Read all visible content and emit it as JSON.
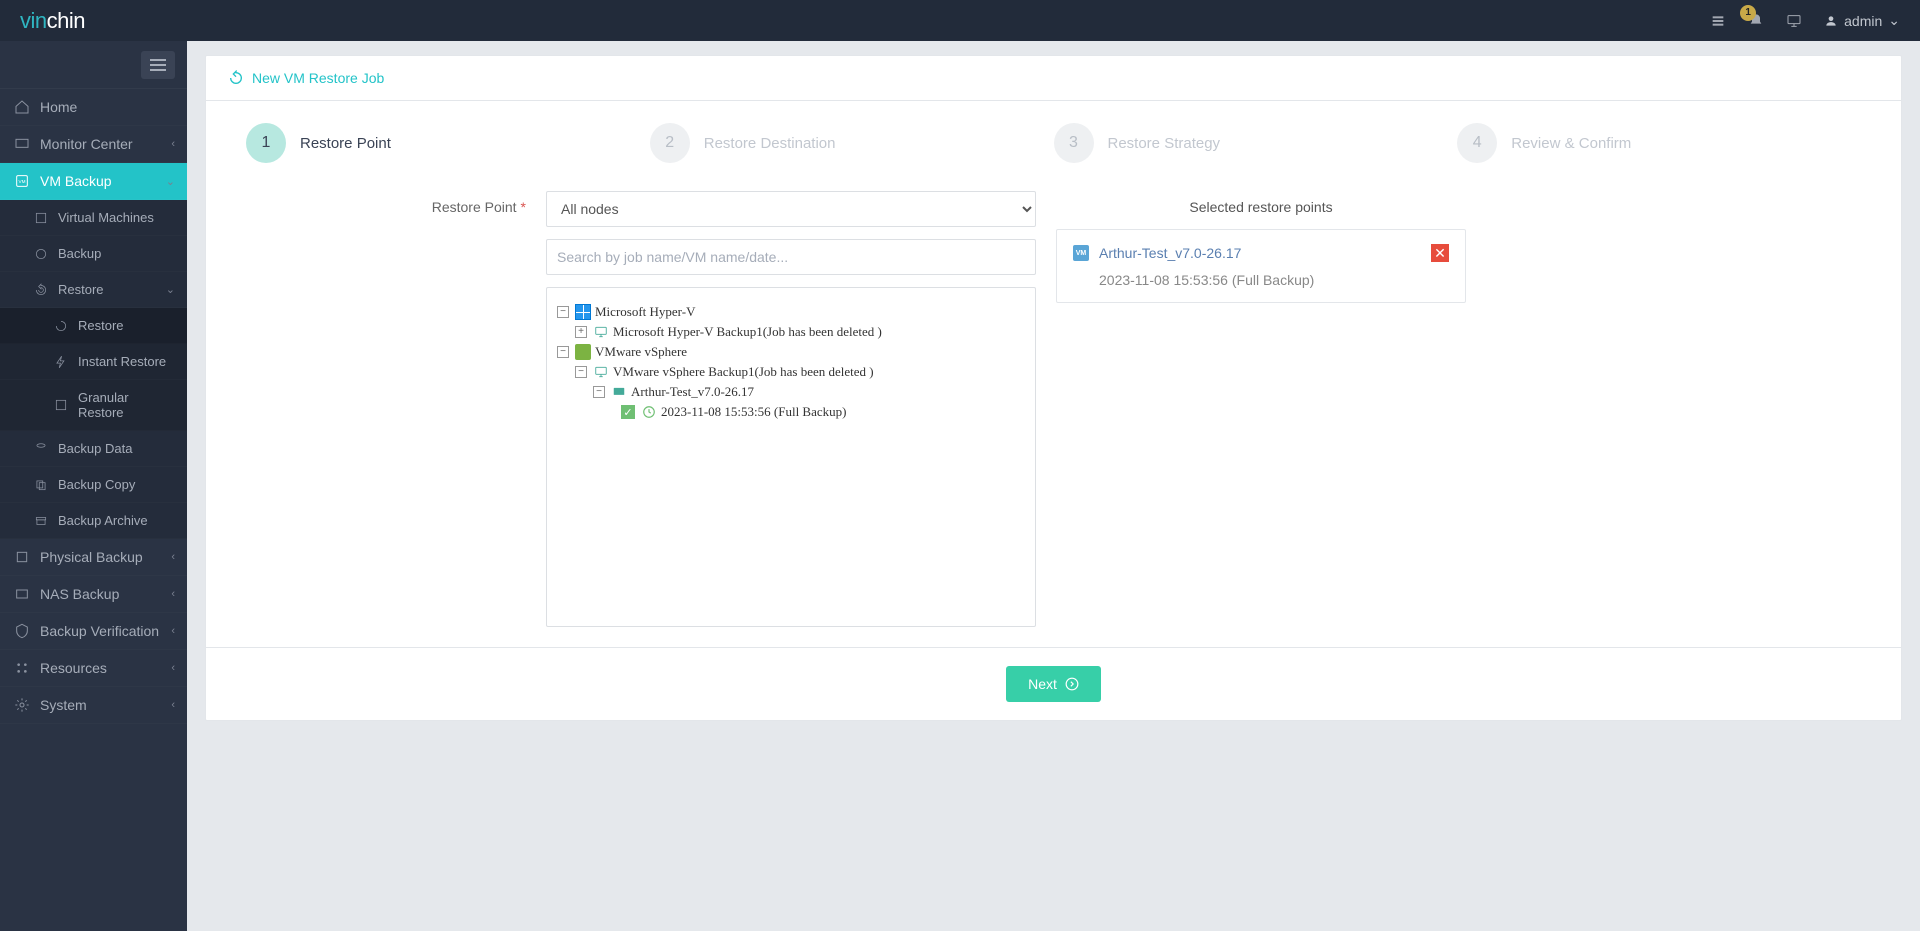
{
  "brand": {
    "part1": "vin",
    "part2": "chin"
  },
  "topbar": {
    "user": "admin",
    "badge": "1"
  },
  "sidebar": {
    "items": [
      {
        "label": "Home"
      },
      {
        "label": "Monitor Center"
      },
      {
        "label": "VM Backup"
      },
      {
        "label": "Physical Backup"
      },
      {
        "label": "NAS Backup"
      },
      {
        "label": "Backup Verification"
      },
      {
        "label": "Resources"
      },
      {
        "label": "System"
      }
    ],
    "vm_backup": [
      {
        "label": "Virtual Machines"
      },
      {
        "label": "Backup"
      },
      {
        "label": "Restore"
      },
      {
        "label": "Backup Data"
      },
      {
        "label": "Backup Copy"
      },
      {
        "label": "Backup Archive"
      }
    ],
    "restore": [
      {
        "label": "Restore"
      },
      {
        "label": "Instant Restore"
      },
      {
        "label": "Granular Restore"
      }
    ]
  },
  "page": {
    "title": "New VM Restore Job",
    "steps": [
      {
        "num": "1",
        "label": "Restore Point"
      },
      {
        "num": "2",
        "label": "Restore Destination"
      },
      {
        "num": "3",
        "label": "Restore Strategy"
      },
      {
        "num": "4",
        "label": "Review & Confirm"
      }
    ],
    "form_label": "Restore Point",
    "node_select": "All nodes",
    "search_placeholder": "Search by job name/VM name/date...",
    "tree": {
      "hyperv": "Microsoft Hyper-V",
      "hyperv_job": "Microsoft Hyper-V Backup1(Job has been deleted )",
      "vsphere": "VMware vSphere",
      "vsphere_job": "VMware vSphere Backup1(Job has been deleted )",
      "vm": "Arthur-Test_v7.0-26.17",
      "point": "2023-11-08 15:53:56 (Full  Backup)"
    },
    "selected": {
      "title": "Selected restore points",
      "vm": "Arthur-Test_v7.0-26.17",
      "time": "2023-11-08 15:53:56 (Full Backup)"
    },
    "next": "Next"
  }
}
